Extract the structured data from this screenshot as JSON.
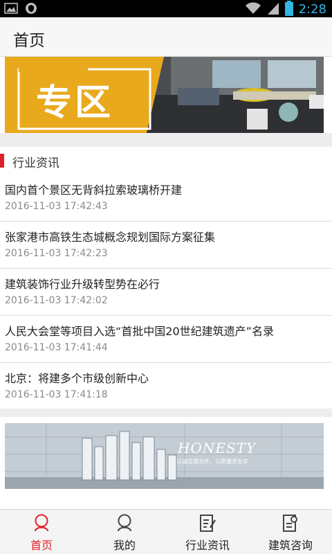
{
  "status_bar": {
    "time": "2:28"
  },
  "header": {
    "title": "首页"
  },
  "banner_top": {
    "text": "专区"
  },
  "section": {
    "title": "行业资讯"
  },
  "news": [
    {
      "title": "国内首个景区无背斜拉索玻璃桥开建",
      "time": "2016-11-03 17:42:43"
    },
    {
      "title": "张家港市高铁生态城概念规划国际方案征集",
      "time": "2016-11-03 17:42:23"
    },
    {
      "title": "建筑装饰行业升级转型势在必行",
      "time": "2016-11-03 17:42:02"
    },
    {
      "title": "人民大会堂等项目入选“首批中国20世纪建筑遗产”名录",
      "time": "2016-11-03 17:41:44"
    },
    {
      "title": "北京：将建多个市级创新中心",
      "time": "2016-11-03 17:41:18"
    }
  ],
  "banner_bottom": {
    "brand": "HONESTY",
    "slogan": "以诚信谋合作，以质量求生存"
  },
  "bottom_nav": [
    {
      "label": "首页",
      "icon": "home-icon",
      "active": true
    },
    {
      "label": "我的",
      "icon": "profile-icon",
      "active": false
    },
    {
      "label": "行业资讯",
      "icon": "news-icon",
      "active": false
    },
    {
      "label": "建筑咨询",
      "icon": "consult-icon",
      "active": false
    }
  ],
  "colors": {
    "accent": "#e02028",
    "status_blue": "#33b5e5"
  }
}
